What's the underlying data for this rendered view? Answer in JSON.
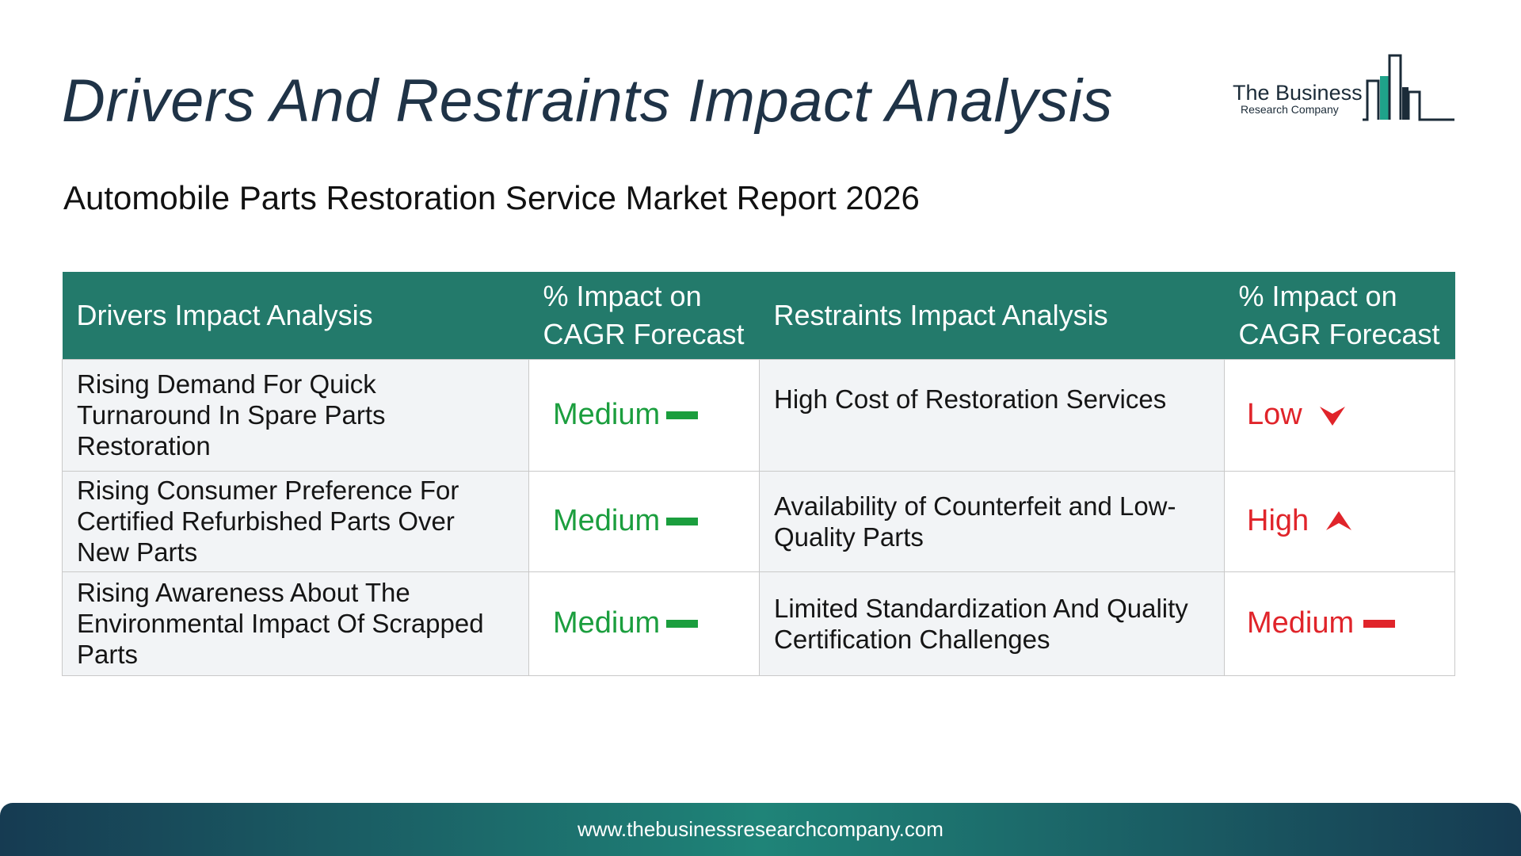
{
  "title": "Drivers And Restraints Impact Analysis",
  "subtitle": "Automobile Parts Restoration Service Market Report 2026",
  "logo": {
    "line1": "The Business",
    "line2": "Research Company"
  },
  "table": {
    "headers": {
      "drivers": "Drivers Impact Analysis",
      "drivers_impact": "% Impact on CAGR Forecast",
      "restraints": "Restraints Impact Analysis",
      "restraints_impact": "% Impact on CAGR Forecast"
    },
    "rows": [
      {
        "driver": "Rising Demand For Quick Turnaround In Spare Parts Restoration",
        "driver_impact": "Medium",
        "driver_trend": "flat",
        "restraint": "High Cost of Restoration Services",
        "restraint_impact": "Low",
        "restraint_trend": "down"
      },
      {
        "driver": "Rising Consumer Preference For Certified Refurbished Parts Over New Parts",
        "driver_impact": "Medium",
        "driver_trend": "flat",
        "restraint": "Availability of Counterfeit and Low-Quality Parts",
        "restraint_impact": "High",
        "restraint_trend": "up"
      },
      {
        "driver": "Rising Awareness About The Environmental Impact Of Scrapped Parts",
        "driver_impact": "Medium",
        "driver_trend": "flat",
        "restraint": "Limited Standardization And Quality Certification Challenges",
        "restraint_impact": "Medium",
        "restraint_trend": "flat"
      }
    ]
  },
  "colors": {
    "header_bg": "#237a6b",
    "positive": "#1b9e3e",
    "negative": "#e0242a",
    "title": "#1f3347"
  },
  "footer": {
    "url": "www.thebusinessresearchcompany.com"
  }
}
